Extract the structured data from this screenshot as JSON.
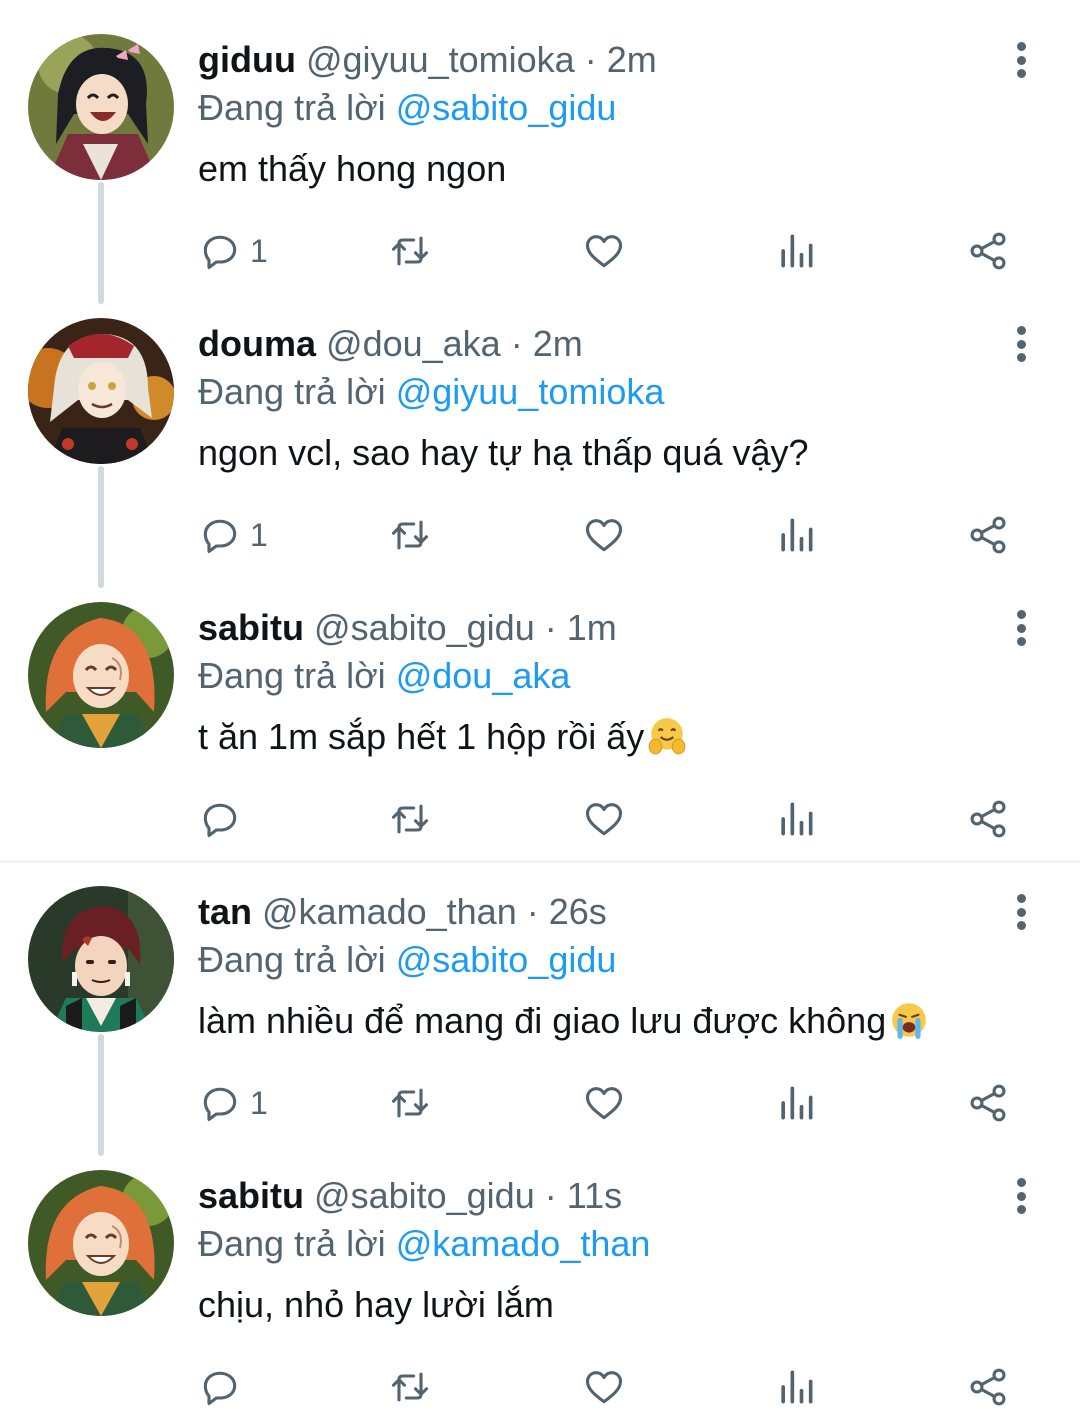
{
  "colors": {
    "accent": "#1d9bf0",
    "muted": "#536471",
    "text": "#0f1419",
    "thread_line": "#cfd9de"
  },
  "reply_prefix": "Đang trả lời",
  "tweets": [
    {
      "name": "giduu",
      "handle": "@giyuu_tomioka",
      "time": "2m",
      "reply_to": "@sabito_gidu",
      "text": "em thấy hong ngon",
      "emoji": "",
      "reply_count": "1",
      "avatar": "avatar-giyuu"
    },
    {
      "name": "douma",
      "handle": "@dou_aka",
      "time": "2m",
      "reply_to": "@giyuu_tomioka",
      "text": "ngon vcl, sao hay tự hạ thấp quá vậy?",
      "emoji": "",
      "reply_count": "1",
      "avatar": "avatar-douma"
    },
    {
      "name": "sabitu",
      "handle": "@sabito_gidu",
      "time": "1m",
      "reply_to": "@dou_aka",
      "text": "t ăn 1m sắp hết 1 hộp rồi ấy",
      "emoji": "hugging-face",
      "reply_count": "",
      "avatar": "avatar-sabito"
    },
    {
      "name": "tan",
      "handle": "@kamado_than",
      "time": "26s",
      "reply_to": "@sabito_gidu",
      "text": "làm nhiều để mang đi giao lưu được không",
      "emoji": "loudly-crying-face",
      "reply_count": "1",
      "avatar": "avatar-tanjiro"
    },
    {
      "name": "sabitu",
      "handle": "@sabito_gidu",
      "time": "11s",
      "reply_to": "@kamado_than",
      "text": "chịu, nhỏ hay lười lắm",
      "emoji": "",
      "reply_count": "",
      "avatar": "avatar-sabito"
    }
  ],
  "icons": {
    "reply": "reply-icon",
    "retweet": "retweet-icon",
    "like": "heart-icon",
    "stats": "stats-icon",
    "share": "share-icon",
    "more": "more-vertical-icon"
  }
}
